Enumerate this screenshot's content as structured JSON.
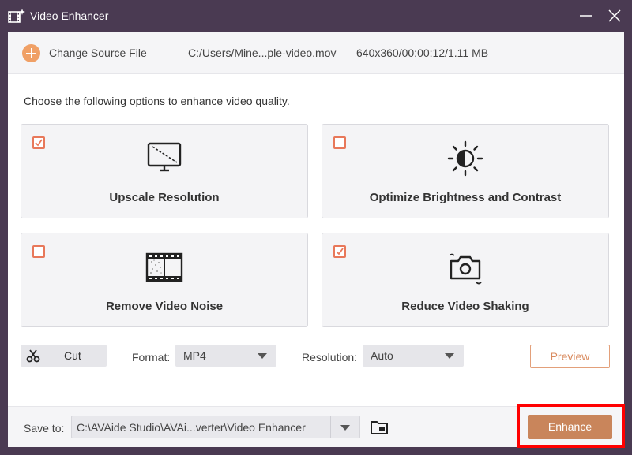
{
  "window": {
    "title": "Video Enhancer",
    "app_icon": "film-sparkle-icon",
    "minimize_icon": "minimize-icon",
    "close_icon": "close-icon"
  },
  "source": {
    "add_icon": "plus-circle-icon",
    "change_label": "Change Source File",
    "path": "C:/Users/Mine...ple-video.mov",
    "meta": "640x360/00:00:12/1.11 MB"
  },
  "instruction": "Choose the following options to enhance video quality.",
  "options": [
    {
      "label": "Upscale Resolution",
      "checked": true,
      "icon": "monitor-upscale-icon"
    },
    {
      "label": "Optimize Brightness and Contrast",
      "checked": false,
      "icon": "brightness-icon"
    },
    {
      "label": "Remove Video Noise",
      "checked": false,
      "icon": "film-noise-icon"
    },
    {
      "label": "Reduce Video Shaking",
      "checked": true,
      "icon": "camera-shake-icon"
    }
  ],
  "controls": {
    "cut_label": "Cut",
    "cut_icon": "scissors-icon",
    "format_label": "Format:",
    "format_value": "MP4",
    "resolution_label": "Resolution:",
    "resolution_value": "Auto",
    "preview_label": "Preview"
  },
  "save": {
    "label": "Save to:",
    "path": "C:\\AVAide Studio\\AVAi...verter\\Video Enhancer",
    "folder_icon": "folder-icon",
    "enhance_label": "Enhance"
  },
  "colors": {
    "titlebar": "#4a3a52",
    "accent": "#e8785a",
    "enhance_button": "#c9855b",
    "highlight": "#ff0000"
  }
}
